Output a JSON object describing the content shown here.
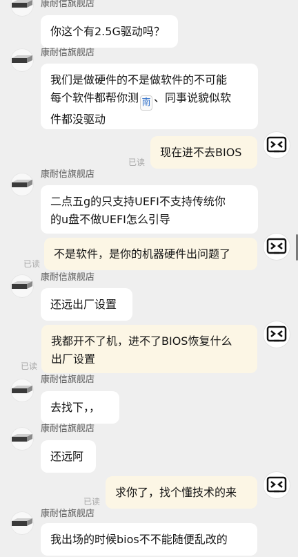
{
  "shop_name": "康耐信旗舰店",
  "read_label": "已读",
  "emoji_char": "南",
  "messages": [
    {
      "text": "你这个有2.5G驱动吗？"
    },
    {
      "line1": "我们是做硬件的不是做软件的不可能",
      "line2_a": "每个软件都帮你测",
      "line2_b": "、同事说貌似软",
      "line3": "件都没驱动"
    },
    {
      "text": "现在进不去BIOS"
    },
    {
      "line1": "二点五g的只支持UEFI不支持传统你",
      "line2": "的u盘不做UEFI怎么引导"
    },
    {
      "text": "不是软件，是你的机器硬件出问题了"
    },
    {
      "text": "还远出厂设置"
    },
    {
      "line1": "我都开不了机，进不了BIOS恢复什么",
      "line2": "出厂设置"
    },
    {
      "text": "去找下，，"
    },
    {
      "text": "还远阿"
    },
    {
      "text": "求你了，找个懂技术的来"
    },
    {
      "text": "我出场的时候bios不不能随便乱改的"
    }
  ]
}
